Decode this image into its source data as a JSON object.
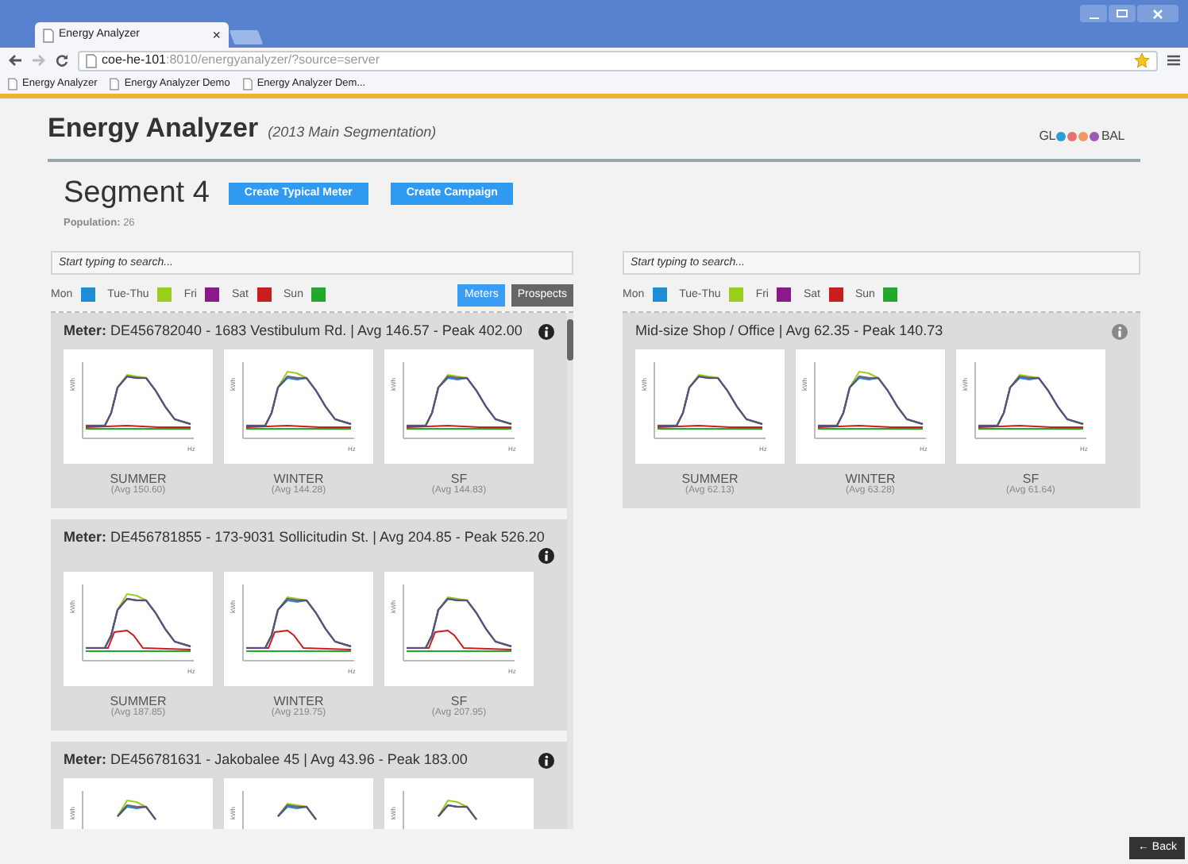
{
  "browser": {
    "tab": {
      "title": "Energy Analyzer",
      "close": "×"
    },
    "url": {
      "host": "coe-he-101",
      "path": ":8010/energyanalyzer/?source=server"
    },
    "bookmarks": [
      "Energy Analyzer",
      "Energy Analyzer Demo",
      "Energy Analyzer Dem..."
    ]
  },
  "header": {
    "title": "Energy Analyzer",
    "subtitle": "(2013 Main Segmentation)",
    "logo": {
      "left": "GL",
      "right": "BAL"
    }
  },
  "segment": {
    "title": "Segment 4",
    "buttons": [
      "Create Typical Meter",
      "Create Campaign"
    ],
    "population_label": "Population:",
    "population": "26"
  },
  "left": {
    "search": {
      "placeholder": "Start typing to search..."
    },
    "legend": [
      {
        "label": "Mon",
        "color": "#1e8fd6"
      },
      {
        "label": "Tue-Thu",
        "color": "#9acd1e"
      },
      {
        "label": "Fri",
        "color": "#8a1a8c"
      },
      {
        "label": "Sat",
        "color": "#c81e1e"
      },
      {
        "label": "Sun",
        "color": "#22a82a"
      }
    ],
    "view_toggle": [
      {
        "label": "Meters",
        "selected": true
      },
      {
        "label": "Prospects",
        "selected": false
      }
    ],
    "meters": [
      {
        "title": "**Meter:** DE456782040 - 1683 Vestibulum Rd. | Avg 146.57 - Peak 402.00",
        "charts": [
          {
            "ylabel": "kWh",
            "xlabel": "Hz",
            "season": "SUMMER",
            "avg": "(Avg 150.60)"
          },
          {
            "ylabel": "kWh",
            "xlabel": "Hz",
            "season": "WINTER",
            "avg": "(Avg 144.28)"
          },
          {
            "ylabel": "kWh",
            "xlabel": "Hz",
            "season": "SF",
            "avg": "(Avg 144.83)"
          }
        ]
      },
      {
        "title": "**Meter:** DE456781855 - 173-9031 Sollicitudin St. | Avg 204.85 - Peak 526.20",
        "charts": [
          {
            "ylabel": "kWh",
            "xlabel": "Hz",
            "season": "SUMMER",
            "avg": "(Avg 187.85)"
          },
          {
            "ylabel": "kWh",
            "xlabel": "Hz",
            "season": "WINTER",
            "avg": "(Avg 219.75)"
          },
          {
            "ylabel": "kWh",
            "xlabel": "Hz",
            "season": "SF",
            "avg": "(Avg 207.95)"
          }
        ]
      },
      {
        "title": "**Meter:** DE456781631 - Jakobalee 45 | Avg 43.96 - Peak 183.00",
        "charts": [
          {
            "ylabel": "kWh"
          },
          {
            "ylabel": "kWh"
          },
          {
            "ylabel": "kWh"
          }
        ]
      }
    ]
  },
  "right": {
    "search": {
      "placeholder": "Start typing to search..."
    },
    "legend": [
      {
        "label": "Mon",
        "color": "#1e8fd6"
      },
      {
        "label": "Tue-Thu",
        "color": "#9acd1e"
      },
      {
        "label": "Fri",
        "color": "#8a1a8c"
      },
      {
        "label": "Sat",
        "color": "#c81e1e"
      },
      {
        "label": "Sun",
        "color": "#22a82a"
      }
    ],
    "meters": [
      {
        "title": "Mid-size Shop / Office | Avg 62.35 - Peak 140.73",
        "charts": [
          {
            "ylabel": "kWh",
            "xlabel": "Hz",
            "season": "SUMMER",
            "avg": "(Avg 62.13)"
          },
          {
            "ylabel": "kWh",
            "xlabel": "Hz",
            "season": "WINTER",
            "avg": "(Avg 63.28)"
          },
          {
            "ylabel": "kWh",
            "xlabel": "Hz",
            "season": "SF",
            "avg": "(Avg 61.64)"
          }
        ]
      }
    ]
  },
  "back_button": "← Back"
}
